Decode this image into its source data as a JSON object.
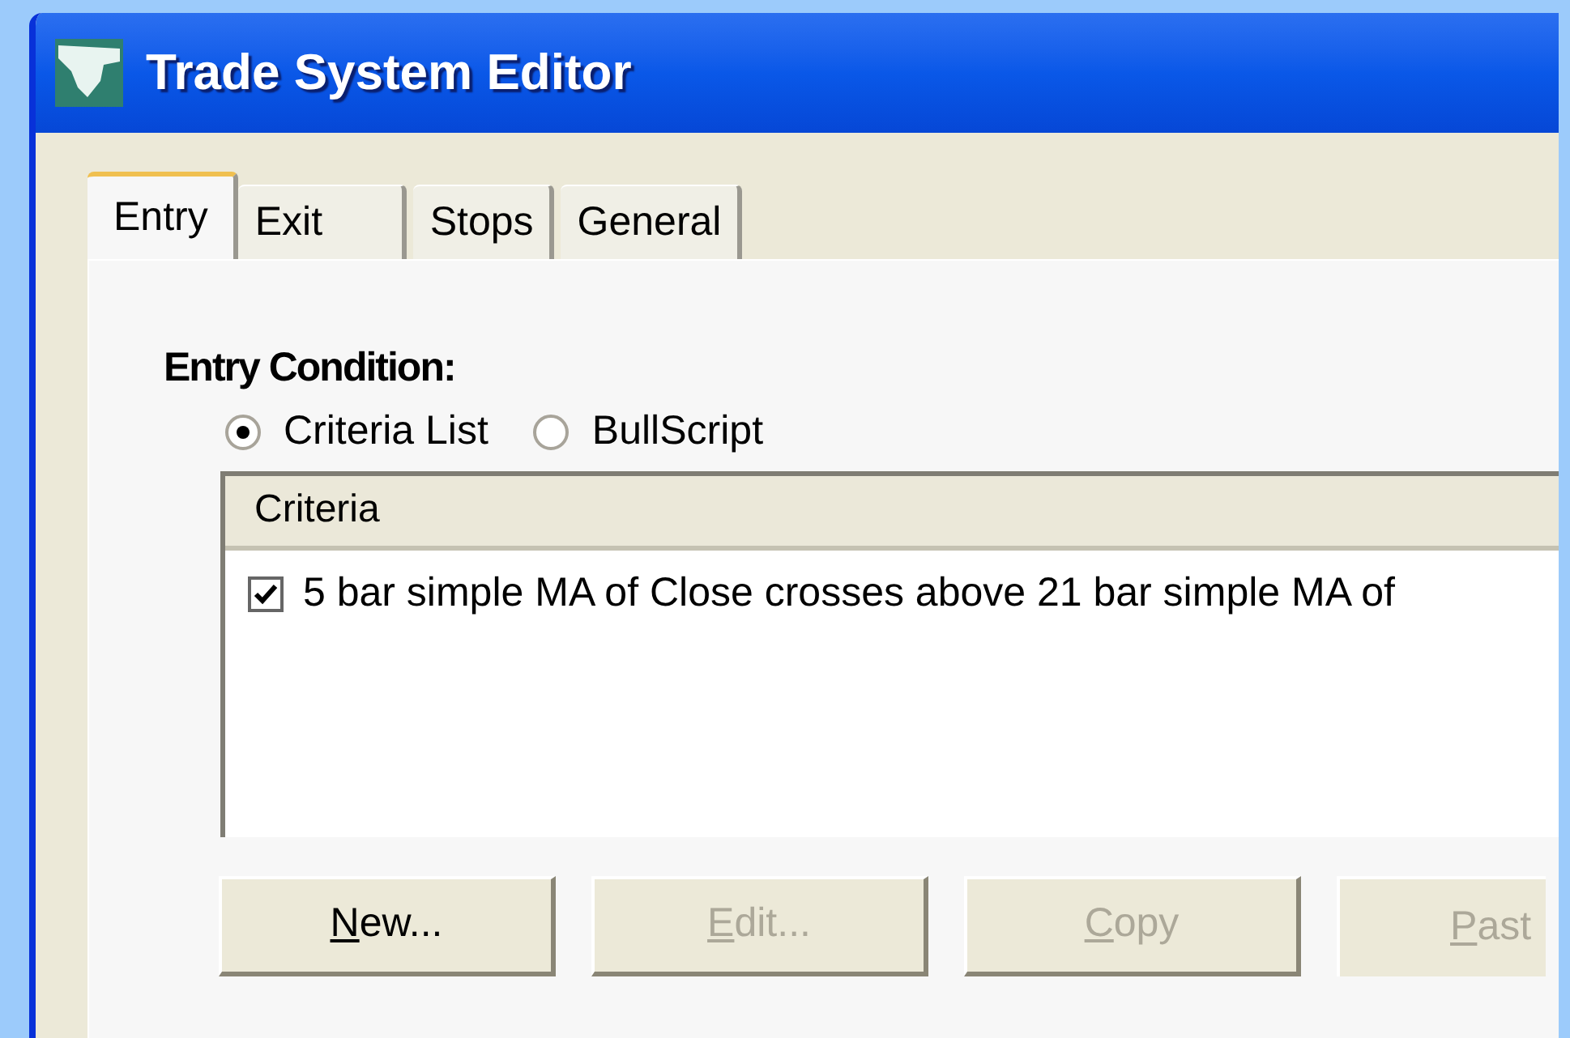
{
  "window": {
    "title": "Trade System Editor"
  },
  "tabs": [
    {
      "label": "Entry",
      "selected": true
    },
    {
      "label": "Exit",
      "selected": false
    },
    {
      "label": "Stops",
      "selected": false
    },
    {
      "label": "General",
      "selected": false
    }
  ],
  "entry_condition": {
    "label": "Entry Condition:",
    "options": [
      {
        "label": "Criteria List",
        "selected": true
      },
      {
        "label": "BullScript",
        "selected": false
      }
    ]
  },
  "criteria_list": {
    "column": "Criteria",
    "rows": [
      {
        "text": "5 bar simple MA of Close crosses above 21 bar simple MA of",
        "checked": true
      }
    ]
  },
  "buttons": [
    {
      "label": "New...",
      "disabled": false
    },
    {
      "label": "Edit...",
      "disabled": true
    },
    {
      "label": "Copy",
      "disabled": true
    },
    {
      "label": "Past",
      "disabled": true
    }
  ]
}
